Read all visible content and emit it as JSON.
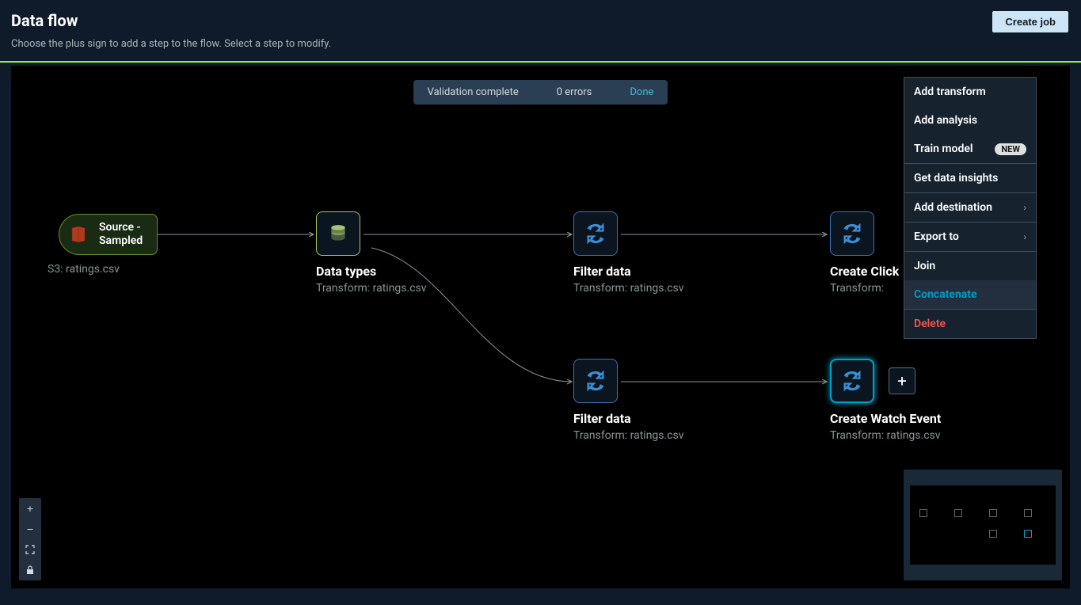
{
  "header": {
    "title": "Data flow",
    "subtitle": "Choose the plus sign to add a step to the flow. Select a step to modify.",
    "create_job": "Create job"
  },
  "validation": {
    "status": "Validation complete",
    "errors": "0 errors",
    "done": "Done"
  },
  "nodes": {
    "source": {
      "line1": "Source -",
      "line2": "Sampled",
      "sub": "S3: ratings.csv"
    },
    "datatypes": {
      "title": "Data types",
      "sub": "Transform: ratings.csv"
    },
    "filter1": {
      "title": "Filter data",
      "sub": "Transform: ratings.csv"
    },
    "filter2": {
      "title": "Filter data",
      "sub": "Transform: ratings.csv"
    },
    "click": {
      "title": "Create Click",
      "sub": "Transform: "
    },
    "watch": {
      "title": "Create Watch Event",
      "sub": "Transform: ratings.csv"
    }
  },
  "menu": {
    "add_transform": "Add transform",
    "add_analysis": "Add analysis",
    "train_model": "Train model",
    "new_badge": "NEW",
    "get_insights": "Get data insights",
    "add_destination": "Add destination",
    "export_to": "Export to",
    "join": "Join",
    "concatenate": "Concatenate",
    "delete": "Delete"
  }
}
